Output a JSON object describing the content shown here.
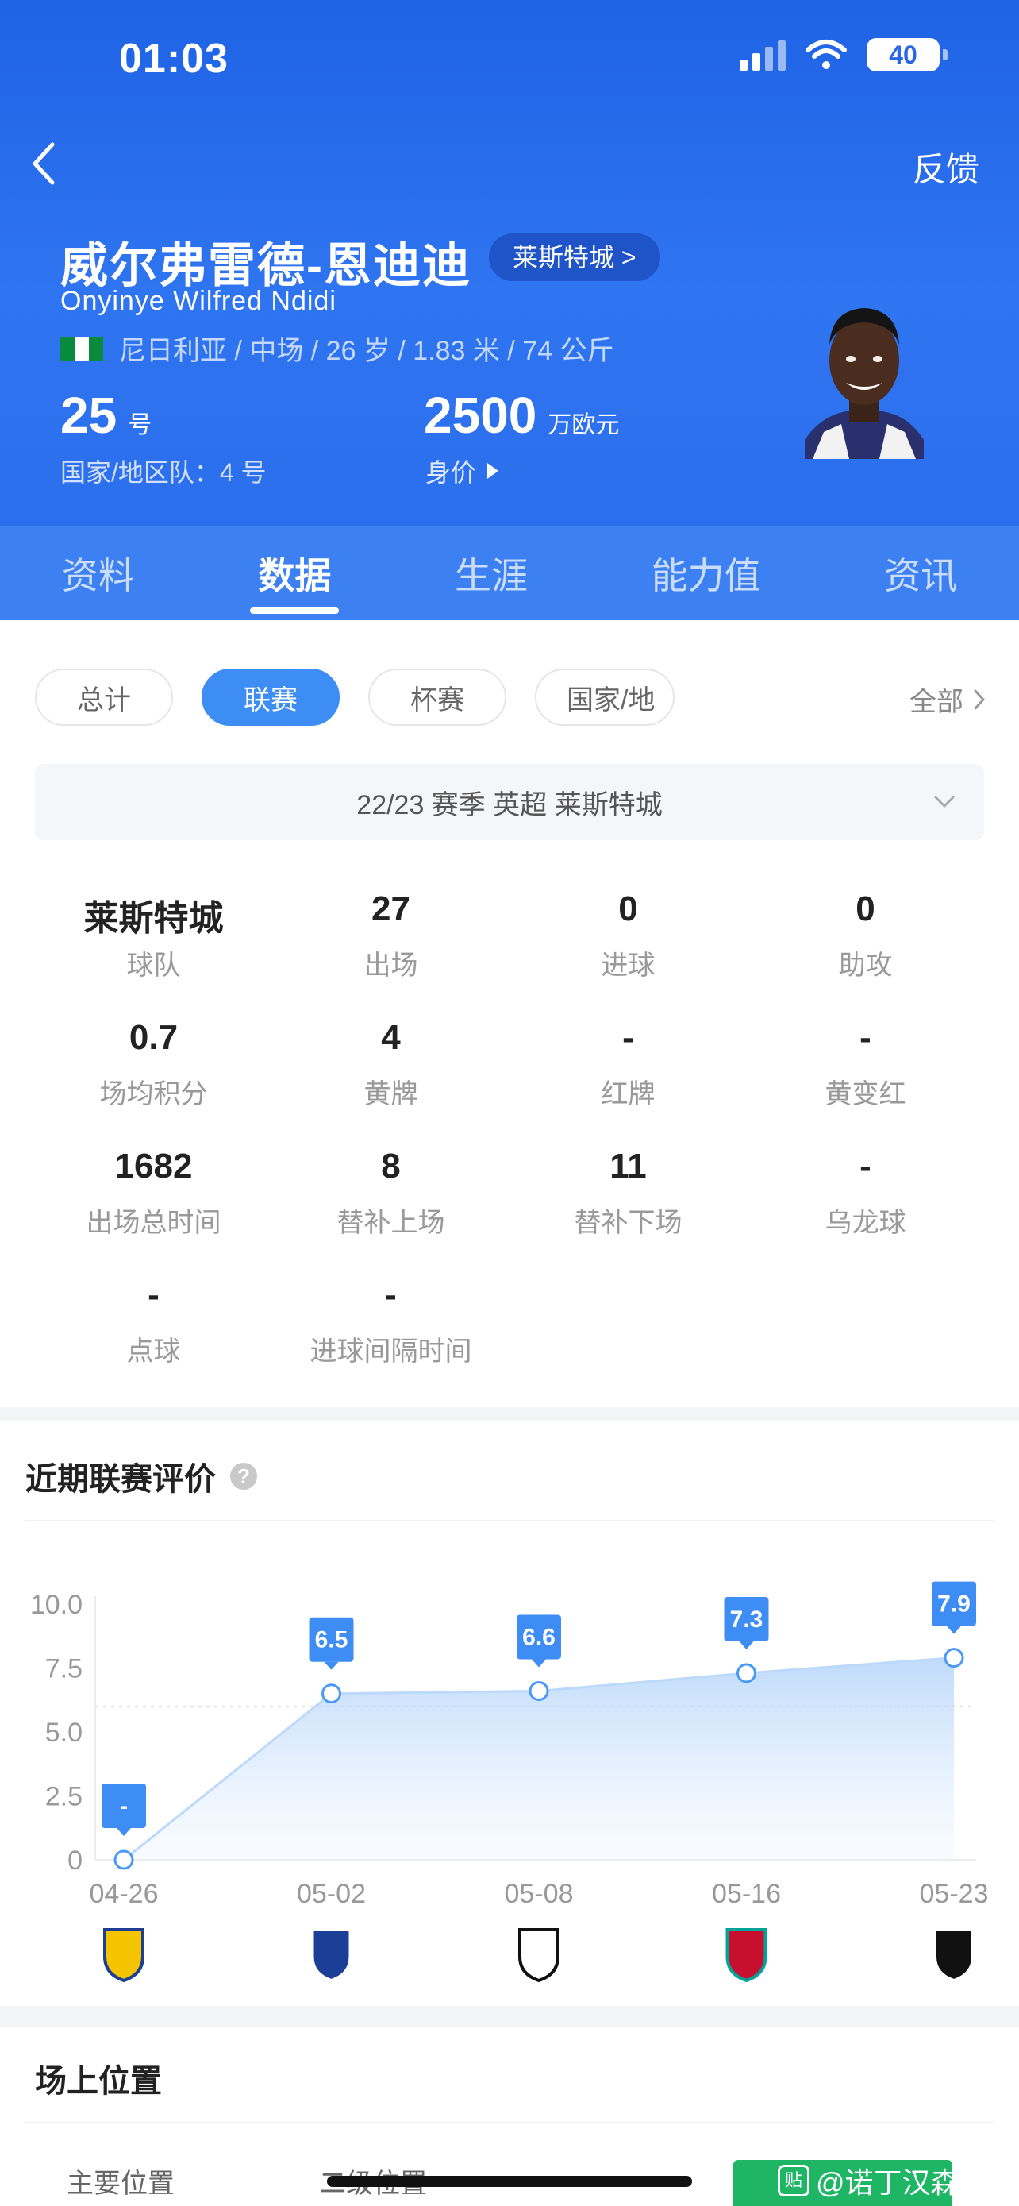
{
  "status_bar": {
    "time": "01:03",
    "battery": "40"
  },
  "header": {
    "feedback": "反馈",
    "name_cn": "威尔弗雷德-恩迪迪",
    "team_link": "莱斯特城 >",
    "name_en": "Onyinye Wilfred Ndidi",
    "info": "尼日利亚 / 中场 / 26 岁 / 1.83 米 / 74 公斤",
    "shirt_number": "25",
    "shirt_unit": "号",
    "national_number": "国家/地区队：4 号",
    "market_value": "2500",
    "market_value_unit": "万欧元",
    "market_value_label": "身价"
  },
  "tabs": [
    {
      "label": "资料",
      "active": false
    },
    {
      "label": "数据",
      "active": true
    },
    {
      "label": "生涯",
      "active": false
    },
    {
      "label": "能力值",
      "active": false
    },
    {
      "label": "资讯",
      "active": false
    }
  ],
  "filters": {
    "chips": [
      "总计",
      "联赛",
      "杯赛",
      "国家/地"
    ],
    "active_index": 1,
    "all_label": "全部"
  },
  "season": "22/23 赛季  英超  莱斯特城",
  "stats": [
    {
      "value": "莱斯特城",
      "label": "球队"
    },
    {
      "value": "27",
      "label": "出场"
    },
    {
      "value": "0",
      "label": "进球"
    },
    {
      "value": "0",
      "label": "助攻"
    },
    {
      "value": "0.7",
      "label": "场均积分"
    },
    {
      "value": "4",
      "label": "黄牌"
    },
    {
      "value": "-",
      "label": "红牌"
    },
    {
      "value": "-",
      "label": "黄变红"
    },
    {
      "value": "1682",
      "label": "出场总时间"
    },
    {
      "value": "8",
      "label": "替补上场"
    },
    {
      "value": "11",
      "label": "替补下场"
    },
    {
      "value": "-",
      "label": "乌龙球"
    },
    {
      "value": "-",
      "label": "点球"
    },
    {
      "value": "-",
      "label": "进球间隔时间"
    }
  ],
  "ratings_section": {
    "title": "近期联赛评价",
    "help": "?"
  },
  "chart_data": {
    "type": "area",
    "categories": [
      "04-26",
      "05-02",
      "05-08",
      "05-16",
      "05-23"
    ],
    "values": [
      0,
      6.5,
      6.6,
      7.3,
      7.9
    ],
    "data_labels": [
      "-",
      "6.5",
      "6.6",
      "7.3",
      "7.9"
    ],
    "y_ticks": [
      "10.0",
      "7.5",
      "5.0",
      "2.5",
      "0"
    ],
    "ylim": [
      0,
      10
    ],
    "opponent_icons": [
      "leeds-crest-icon",
      "everton-crest-icon",
      "fulham-crest-icon",
      "liverpool-crest-icon",
      "newcastle-crest-icon"
    ],
    "line_color": "#4a9af5",
    "label_color": "#3d8df5"
  },
  "position_section": {
    "title": "场上位置",
    "main_label": "主要位置",
    "secondary_label": "二级位置",
    "watermark": "@诺丁汉森",
    "watermark_badge": "贴"
  }
}
